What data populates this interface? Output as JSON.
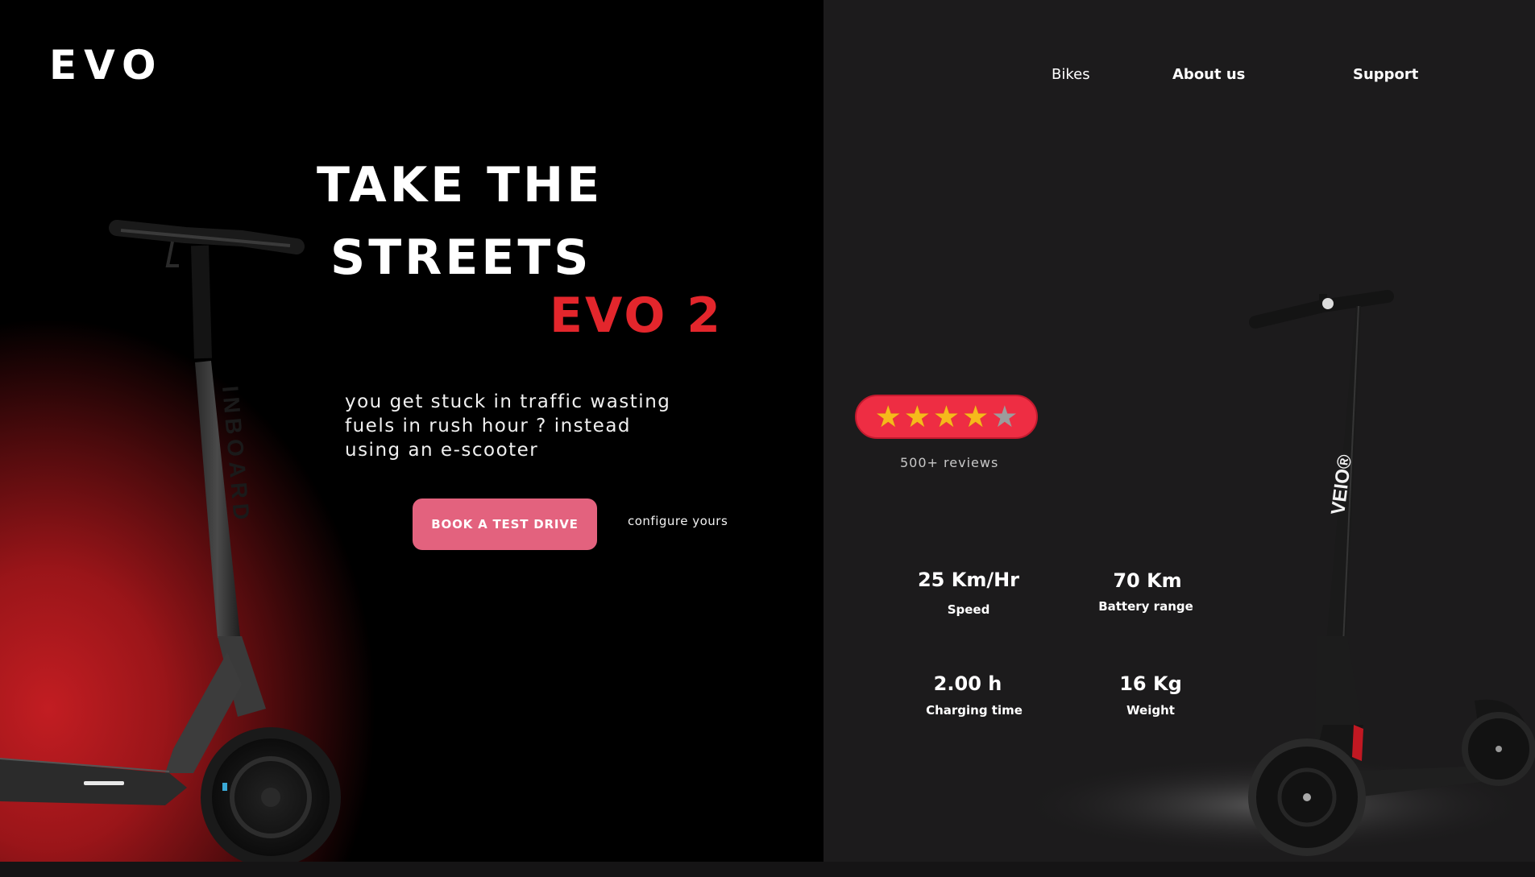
{
  "brand": {
    "logo": "EVO"
  },
  "nav": {
    "items": [
      "Bikes",
      "About us",
      "Support"
    ]
  },
  "hero": {
    "headline_line1": "TAKE THE",
    "headline_line2": "STREETS",
    "model": "EVO 2",
    "description_lines": [
      "you get stuck in traffic wasting",
      "fuels  in rush hour ? instead",
      "using an e-scooter"
    ],
    "cta_label": "BOOK A TEST DRIVE",
    "secondary_label": "configure yours",
    "scooter_decal": "INBOARD"
  },
  "rating": {
    "stars_filled": 4,
    "stars_total": 5,
    "reviews_label": "500+ reviews"
  },
  "specs": [
    {
      "value": "25 Km/Hr",
      "label": "Speed"
    },
    {
      "value": "70 Km",
      "label": "Battery range"
    },
    {
      "value": "2.00 h",
      "label": "Charging time"
    },
    {
      "value": "16 Kg",
      "label": "Weight"
    }
  ],
  "product": {
    "decal": "VEIO®"
  },
  "colors": {
    "accent_red": "#e3262c",
    "cta_pink": "#e3627e",
    "rating_red": "#ee2d43",
    "star_gold": "#f6b91b",
    "panel_dark": "#1c1b1c"
  }
}
